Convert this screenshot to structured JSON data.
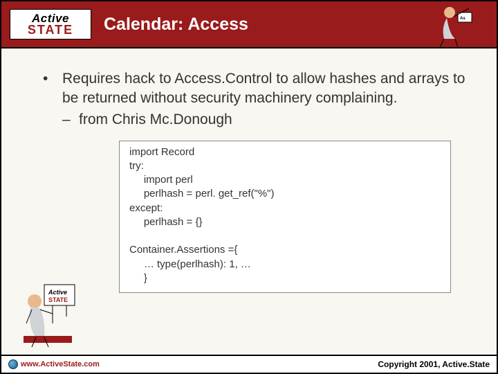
{
  "logo": {
    "line1": "Active",
    "line2": "STATE"
  },
  "title": "Calendar: Access",
  "bullet": "Requires hack to Access.Control to allow hashes and arrays to be returned without security machinery complaining.",
  "subbullet": "from Chris Mc.Donough",
  "code": "import Record\ntry:\n     import perl\n     perlhash = perl. get_ref(\"%\")\nexcept:\n     perlhash = {}\n\nContainer.Assertions ={\n     … type(perlhash): 1, …\n     }",
  "footer": {
    "url": "www.ActiveState.com",
    "copyright": "Copyright 2001, Active.State"
  }
}
